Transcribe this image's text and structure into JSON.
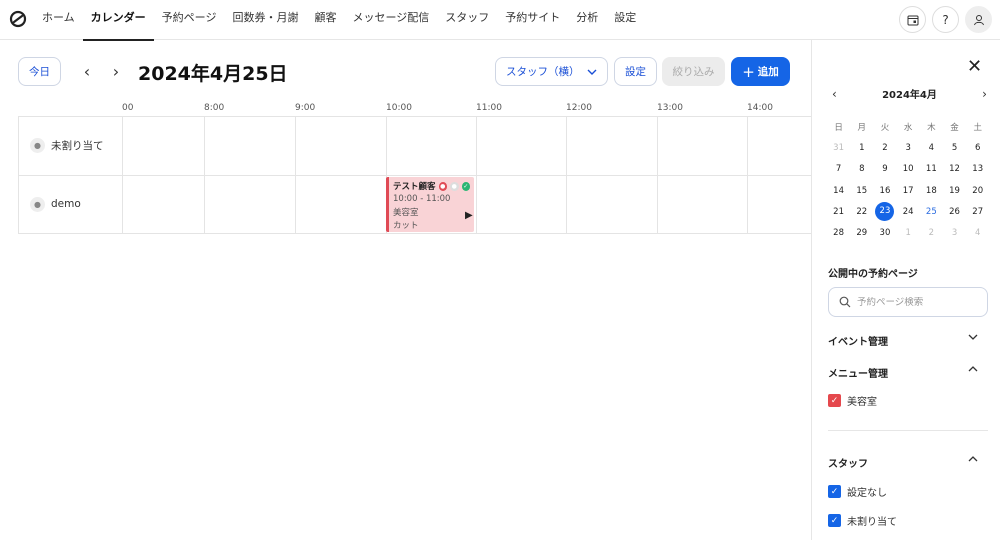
{
  "nav": {
    "items": [
      "ホーム",
      "カレンダー",
      "予約ページ",
      "回数券・月謝",
      "顧客",
      "メッセージ配信",
      "スタッフ",
      "予約サイト",
      "分析",
      "設定"
    ],
    "active": "カレンダー",
    "icons": [
      "calendar-window-icon",
      "help-icon",
      "user-icon"
    ],
    "help_label": "?"
  },
  "toolbar": {
    "today": "今日",
    "prev": "‹",
    "next": "›",
    "date": "2024年4月25日",
    "view_select": "スタッフ（横）",
    "settings": "設定",
    "filter": "絞り込み",
    "add": "追加"
  },
  "timeline": {
    "hours": [
      "00",
      "8:00",
      "9:00",
      "10:00",
      "11:00",
      "12:00",
      "13:00",
      "14:00"
    ],
    "rows": [
      "未割り当て",
      "demo"
    ],
    "event": {
      "title": "テスト顧客",
      "time": "10:00 - 11:00",
      "menu": "美容室",
      "service": "カット",
      "color": "#f9d3d6",
      "accent": "#e04a55"
    }
  },
  "sidebar": {
    "month": "2024年4月",
    "weekdays": [
      "日",
      "月",
      "火",
      "水",
      "木",
      "金",
      "土"
    ],
    "weeks": [
      [
        "31",
        "1",
        "2",
        "3",
        "4",
        "5",
        "6"
      ],
      [
        "7",
        "8",
        "9",
        "10",
        "11",
        "12",
        "13"
      ],
      [
        "14",
        "15",
        "16",
        "17",
        "18",
        "19",
        "20"
      ],
      [
        "21",
        "22",
        "23",
        "24",
        "25",
        "26",
        "27"
      ],
      [
        "28",
        "29",
        "30",
        "1",
        "2",
        "3",
        "4"
      ]
    ],
    "selected_day": "23",
    "linked_day": "25",
    "public_pages_title": "公開中の予約ページ",
    "search_placeholder": "予約ページ検索",
    "event_mgmt": "イベント管理",
    "menu_mgmt": "メニュー管理",
    "menu_items": [
      {
        "label": "美容室",
        "color": "#e5484d",
        "checked": true
      }
    ],
    "staff_title": "スタッフ",
    "staff_items": [
      {
        "label": "設定なし",
        "color": "#1565e6",
        "checked": true
      },
      {
        "label": "未割り当て",
        "color": "#1565e6",
        "checked": true
      }
    ]
  },
  "colors": {
    "accent": "#1565e6"
  }
}
